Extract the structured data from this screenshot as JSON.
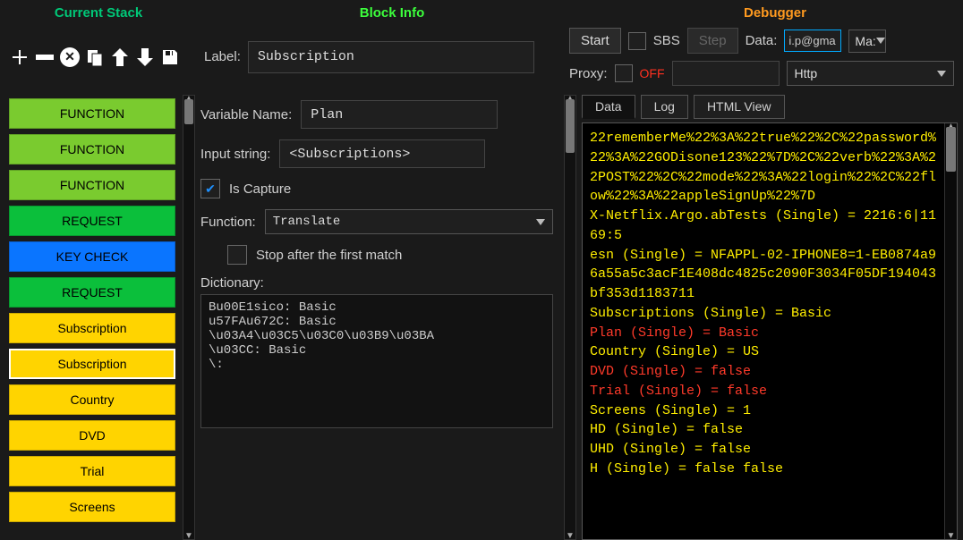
{
  "headers": {
    "stack": "Current Stack",
    "info": "Block Info",
    "debugger": "Debugger"
  },
  "toolbar_icons": [
    "plus",
    "minus",
    "delete",
    "duplicate",
    "up",
    "down",
    "save"
  ],
  "label_field": {
    "label": "Label:",
    "value": "Subscription"
  },
  "debugger": {
    "start": "Start",
    "sbs": "SBS",
    "step": "Step",
    "data_label": "Data:",
    "data_value": "i.p@gma",
    "mask": "Ma:",
    "proxy_label": "Proxy:",
    "proxy_state": "OFF",
    "proxy_type": "Http"
  },
  "stack": [
    {
      "label": "FUNCTION",
      "cls": "fn"
    },
    {
      "label": "FUNCTION",
      "cls": "fn"
    },
    {
      "label": "FUNCTION",
      "cls": "fn"
    },
    {
      "label": "REQUEST",
      "cls": "req"
    },
    {
      "label": "KEY CHECK",
      "cls": "key"
    },
    {
      "label": "REQUEST",
      "cls": "req"
    },
    {
      "label": "Subscription",
      "cls": "sub"
    },
    {
      "label": "Subscription",
      "cls": "sub",
      "selected": true
    },
    {
      "label": "Country",
      "cls": "sub"
    },
    {
      "label": "DVD",
      "cls": "sub"
    },
    {
      "label": "Trial",
      "cls": "sub"
    },
    {
      "label": "Screens",
      "cls": "sub"
    }
  ],
  "block_info": {
    "var_name_label": "Variable Name:",
    "var_name": "Plan",
    "input_string_label": "Input string:",
    "input_string": "<Subscriptions>",
    "is_capture_label": "Is Capture",
    "is_capture": true,
    "function_label": "Function:",
    "function": "Translate",
    "stop_first_label": "Stop after the first match",
    "stop_first": false,
    "dictionary_label": "Dictionary:",
    "dictionary": "Bu00E1sico: Basic\nu57FAu672C: Basic\n\\u03A4\\u03C5\\u03C0\\u03B9\\u03BA\n\\u03CC: Basic\n\\:"
  },
  "tabs": {
    "data": "Data",
    "log": "Log",
    "html": "HTML View"
  },
  "console": [
    {
      "c": "y",
      "t": "22rememberMe%22%3A%22true%22%2C%22password%22%3A%22GODisone123%22%7D%2C%22verb%22%3A%22POST%22%2C%22mode%22%3A%22login%22%2C%22flow%22%3A%22appleSignUp%22%7D"
    },
    {
      "c": "y",
      "t": "X-Netflix.Argo.abTests (Single) = 2216:6|1169:5"
    },
    {
      "c": "y",
      "t": "esn (Single) = NFAPPL-02-IPHONE8=1-EB0874a96a55a5c3acF1E408dc4825c2090F3034F05DF194043bf353d1183711"
    },
    {
      "c": "y",
      "t": "Subscriptions (Single) = Basic"
    },
    {
      "c": "r",
      "t": "Plan (Single) = Basic"
    },
    {
      "c": "y",
      "t": "Country (Single) = US"
    },
    {
      "c": "r",
      "t": "DVD (Single) = false"
    },
    {
      "c": "r",
      "t": "Trial (Single) = false"
    },
    {
      "c": "y",
      "t": "Screens (Single) = 1"
    },
    {
      "c": "y",
      "t": "HD (Single) = false"
    },
    {
      "c": "y",
      "t": "UHD (Single) = false"
    },
    {
      "c": "y",
      "t": "H (Single) = false false"
    }
  ]
}
